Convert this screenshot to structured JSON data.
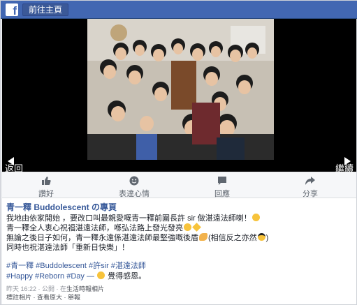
{
  "topbar": {
    "home_label": "前往主頁"
  },
  "viewer": {
    "prev_label": "返回",
    "next_label": "繼續"
  },
  "actions": [
    {
      "label": "讚好",
      "icon": "thumbs-up-icon"
    },
    {
      "label": "表達心情",
      "icon": "smiley-icon"
    },
    {
      "label": "回應",
      "icon": "comment-bubble-icon"
    },
    {
      "label": "分享",
      "icon": "share-arrow-icon"
    }
  ],
  "post": {
    "page_title": "青一釋 Buddolescent の專頁",
    "lines": [
      "我地由依家開始 ，要改口叫最親愛嘅青一釋前圍長許 sir 做湛遠法師喇！",
      "青一釋全人衷心祝福湛遠法師，喺弘法路上發光發亮",
      "無論之後日子如何，青一釋永遠係湛遠法師最堅強嘅後盾",
      "(相信反之亦然",
      ")",
      "同時也祝湛遠法師「重新日快樂」！"
    ],
    "hashtags_line1": "#青一釋 #Buddolescent #許sir #湛遠法師",
    "hashtags_line2": "#Happy #Reborn #Day —",
    "feeling": "覺得感恩。",
    "meta_time": "昨天 16:22 · 公開 · 在",
    "meta_album": "生活時報相片",
    "meta_links": "標註相片 · 查看原大 · 舉報"
  },
  "colors": {
    "brand": "#4267b2",
    "link": "#365899",
    "bg": "#e9ebee"
  }
}
